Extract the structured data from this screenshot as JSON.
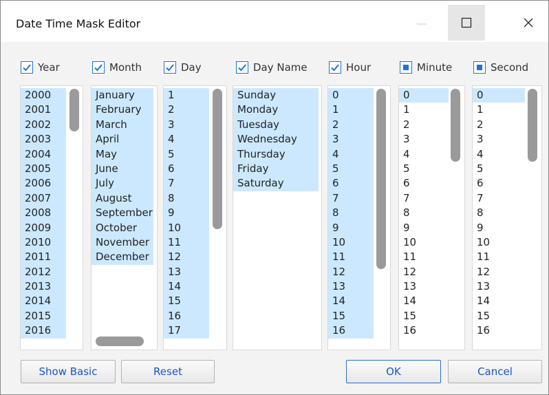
{
  "window": {
    "title": "Date Time Mask Editor"
  },
  "columns": [
    {
      "key": "year",
      "label": "Year",
      "check": "checked",
      "items": [
        "2000",
        "2001",
        "2002",
        "2003",
        "2004",
        "2005",
        "2006",
        "2007",
        "2008",
        "2009",
        "2010",
        "2011",
        "2012",
        "2013",
        "2014",
        "2015",
        "2016"
      ],
      "selected_all": true
    },
    {
      "key": "month",
      "label": "Month",
      "check": "checked",
      "items": [
        "January",
        "February",
        "March",
        "April",
        "May",
        "June",
        "July",
        "August",
        "September",
        "October",
        "November",
        "December"
      ],
      "selected_all": true
    },
    {
      "key": "day",
      "label": "Day",
      "check": "checked",
      "items": [
        "1",
        "2",
        "3",
        "4",
        "5",
        "6",
        "7",
        "8",
        "9",
        "10",
        "11",
        "12",
        "13",
        "14",
        "15",
        "16",
        "17"
      ],
      "selected_all": true
    },
    {
      "key": "dayname",
      "label": "Day Name",
      "check": "checked",
      "items": [
        "Sunday",
        "Monday",
        "Tuesday",
        "Wednesday",
        "Thursday",
        "Friday",
        "Saturday"
      ],
      "selected_all": true
    },
    {
      "key": "hour",
      "label": "Hour",
      "check": "checked",
      "items": [
        "0",
        "1",
        "2",
        "3",
        "4",
        "5",
        "6",
        "7",
        "8",
        "9",
        "10",
        "11",
        "12",
        "13",
        "14",
        "15",
        "16"
      ],
      "selected_all": true
    },
    {
      "key": "minute",
      "label": "Minute",
      "check": "indeterminate",
      "items": [
        "0",
        "1",
        "2",
        "3",
        "4",
        "5",
        "6",
        "7",
        "8",
        "9",
        "10",
        "11",
        "12",
        "13",
        "14",
        "15",
        "16"
      ],
      "selected_first": true
    },
    {
      "key": "second",
      "label": "Second",
      "check": "indeterminate",
      "items": [
        "0",
        "1",
        "2",
        "3",
        "4",
        "5",
        "6",
        "7",
        "8",
        "9",
        "10",
        "11",
        "12",
        "13",
        "14",
        "15",
        "16"
      ],
      "selected_first": true
    }
  ],
  "buttons": {
    "show_basic": "Show Basic",
    "reset": "Reset",
    "ok": "OK",
    "cancel": "Cancel"
  },
  "colors": {
    "selection": "#cce8ff",
    "checkbox_accent": "#1e73d6",
    "button_text": "#1a56c4"
  }
}
